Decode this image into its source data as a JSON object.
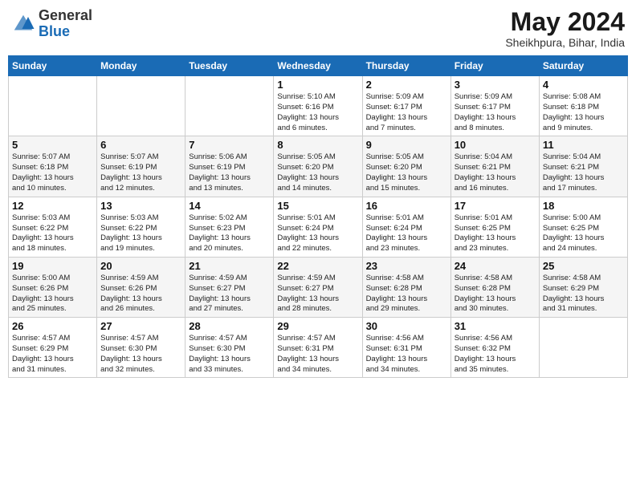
{
  "logo": {
    "general": "General",
    "blue": "Blue"
  },
  "title": "May 2024",
  "location": "Sheikhpura, Bihar, India",
  "headers": [
    "Sunday",
    "Monday",
    "Tuesday",
    "Wednesday",
    "Thursday",
    "Friday",
    "Saturday"
  ],
  "weeks": [
    [
      {
        "day": "",
        "info": ""
      },
      {
        "day": "",
        "info": ""
      },
      {
        "day": "",
        "info": ""
      },
      {
        "day": "1",
        "info": "Sunrise: 5:10 AM\nSunset: 6:16 PM\nDaylight: 13 hours\nand 6 minutes."
      },
      {
        "day": "2",
        "info": "Sunrise: 5:09 AM\nSunset: 6:17 PM\nDaylight: 13 hours\nand 7 minutes."
      },
      {
        "day": "3",
        "info": "Sunrise: 5:09 AM\nSunset: 6:17 PM\nDaylight: 13 hours\nand 8 minutes."
      },
      {
        "day": "4",
        "info": "Sunrise: 5:08 AM\nSunset: 6:18 PM\nDaylight: 13 hours\nand 9 minutes."
      }
    ],
    [
      {
        "day": "5",
        "info": "Sunrise: 5:07 AM\nSunset: 6:18 PM\nDaylight: 13 hours\nand 10 minutes."
      },
      {
        "day": "6",
        "info": "Sunrise: 5:07 AM\nSunset: 6:19 PM\nDaylight: 13 hours\nand 12 minutes."
      },
      {
        "day": "7",
        "info": "Sunrise: 5:06 AM\nSunset: 6:19 PM\nDaylight: 13 hours\nand 13 minutes."
      },
      {
        "day": "8",
        "info": "Sunrise: 5:05 AM\nSunset: 6:20 PM\nDaylight: 13 hours\nand 14 minutes."
      },
      {
        "day": "9",
        "info": "Sunrise: 5:05 AM\nSunset: 6:20 PM\nDaylight: 13 hours\nand 15 minutes."
      },
      {
        "day": "10",
        "info": "Sunrise: 5:04 AM\nSunset: 6:21 PM\nDaylight: 13 hours\nand 16 minutes."
      },
      {
        "day": "11",
        "info": "Sunrise: 5:04 AM\nSunset: 6:21 PM\nDaylight: 13 hours\nand 17 minutes."
      }
    ],
    [
      {
        "day": "12",
        "info": "Sunrise: 5:03 AM\nSunset: 6:22 PM\nDaylight: 13 hours\nand 18 minutes."
      },
      {
        "day": "13",
        "info": "Sunrise: 5:03 AM\nSunset: 6:22 PM\nDaylight: 13 hours\nand 19 minutes."
      },
      {
        "day": "14",
        "info": "Sunrise: 5:02 AM\nSunset: 6:23 PM\nDaylight: 13 hours\nand 20 minutes."
      },
      {
        "day": "15",
        "info": "Sunrise: 5:01 AM\nSunset: 6:24 PM\nDaylight: 13 hours\nand 22 minutes."
      },
      {
        "day": "16",
        "info": "Sunrise: 5:01 AM\nSunset: 6:24 PM\nDaylight: 13 hours\nand 23 minutes."
      },
      {
        "day": "17",
        "info": "Sunrise: 5:01 AM\nSunset: 6:25 PM\nDaylight: 13 hours\nand 23 minutes."
      },
      {
        "day": "18",
        "info": "Sunrise: 5:00 AM\nSunset: 6:25 PM\nDaylight: 13 hours\nand 24 minutes."
      }
    ],
    [
      {
        "day": "19",
        "info": "Sunrise: 5:00 AM\nSunset: 6:26 PM\nDaylight: 13 hours\nand 25 minutes."
      },
      {
        "day": "20",
        "info": "Sunrise: 4:59 AM\nSunset: 6:26 PM\nDaylight: 13 hours\nand 26 minutes."
      },
      {
        "day": "21",
        "info": "Sunrise: 4:59 AM\nSunset: 6:27 PM\nDaylight: 13 hours\nand 27 minutes."
      },
      {
        "day": "22",
        "info": "Sunrise: 4:59 AM\nSunset: 6:27 PM\nDaylight: 13 hours\nand 28 minutes."
      },
      {
        "day": "23",
        "info": "Sunrise: 4:58 AM\nSunset: 6:28 PM\nDaylight: 13 hours\nand 29 minutes."
      },
      {
        "day": "24",
        "info": "Sunrise: 4:58 AM\nSunset: 6:28 PM\nDaylight: 13 hours\nand 30 minutes."
      },
      {
        "day": "25",
        "info": "Sunrise: 4:58 AM\nSunset: 6:29 PM\nDaylight: 13 hours\nand 31 minutes."
      }
    ],
    [
      {
        "day": "26",
        "info": "Sunrise: 4:57 AM\nSunset: 6:29 PM\nDaylight: 13 hours\nand 31 minutes."
      },
      {
        "day": "27",
        "info": "Sunrise: 4:57 AM\nSunset: 6:30 PM\nDaylight: 13 hours\nand 32 minutes."
      },
      {
        "day": "28",
        "info": "Sunrise: 4:57 AM\nSunset: 6:30 PM\nDaylight: 13 hours\nand 33 minutes."
      },
      {
        "day": "29",
        "info": "Sunrise: 4:57 AM\nSunset: 6:31 PM\nDaylight: 13 hours\nand 34 minutes."
      },
      {
        "day": "30",
        "info": "Sunrise: 4:56 AM\nSunset: 6:31 PM\nDaylight: 13 hours\nand 34 minutes."
      },
      {
        "day": "31",
        "info": "Sunrise: 4:56 AM\nSunset: 6:32 PM\nDaylight: 13 hours\nand 35 minutes."
      },
      {
        "day": "",
        "info": ""
      }
    ]
  ]
}
